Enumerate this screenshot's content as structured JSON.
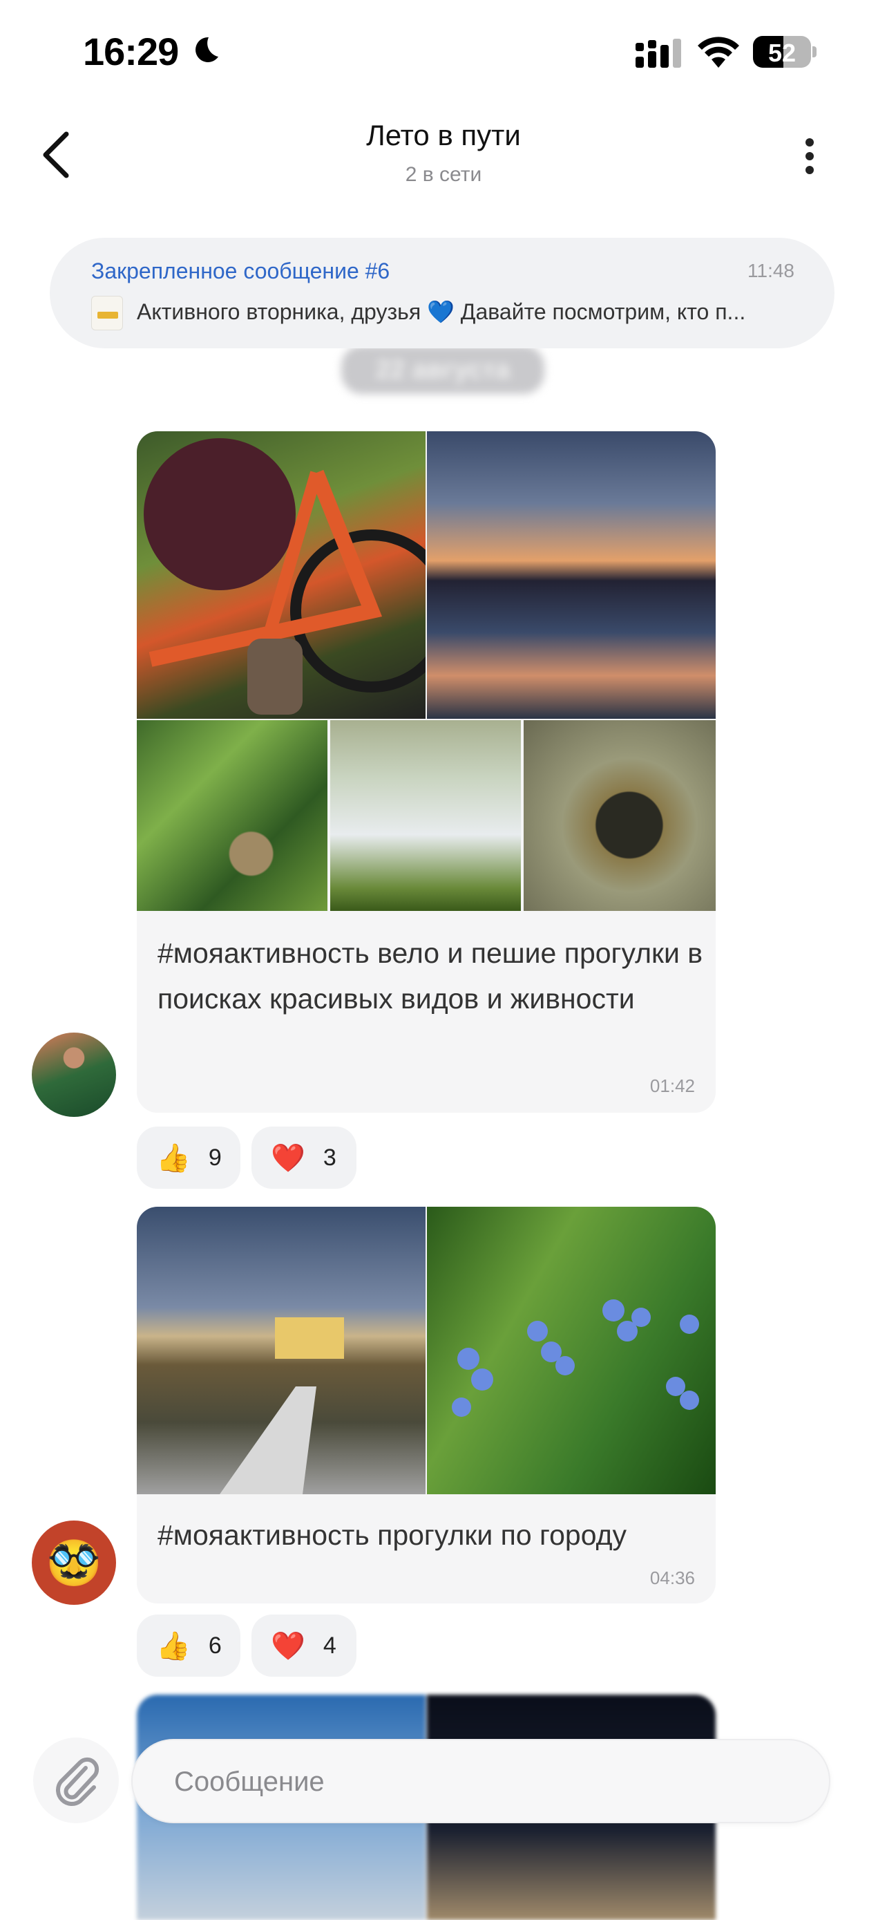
{
  "status_bar": {
    "time": "16:29",
    "battery": "52"
  },
  "header": {
    "title": "Лето в пути",
    "subtitle": "2 в сети"
  },
  "pinned": {
    "title": "Закрепленное сообщение #6",
    "time": "11:48",
    "text": "Активного вторника, друзья 💙 Давайте посмотрим, кто п..."
  },
  "date_pill": "22 августа",
  "messages": [
    {
      "text": "#мояактивность вело и пешие прогулки в поисках красивых видов и живности",
      "time": "01:42",
      "reactions": [
        {
          "emoji": "👍",
          "count": "9"
        },
        {
          "emoji": "❤️",
          "count": "3"
        }
      ]
    },
    {
      "text": "#мояактивность прогулки по городу",
      "time": "04:36",
      "reactions": [
        {
          "emoji": "👍",
          "count": "6"
        },
        {
          "emoji": "❤️",
          "count": "4"
        }
      ]
    }
  ],
  "composer": {
    "placeholder": "Сообщение"
  },
  "colors": {
    "link_blue": "#2f67c8",
    "bubble_bg": "#f5f5f6",
    "muted": "#8a8a8e"
  }
}
